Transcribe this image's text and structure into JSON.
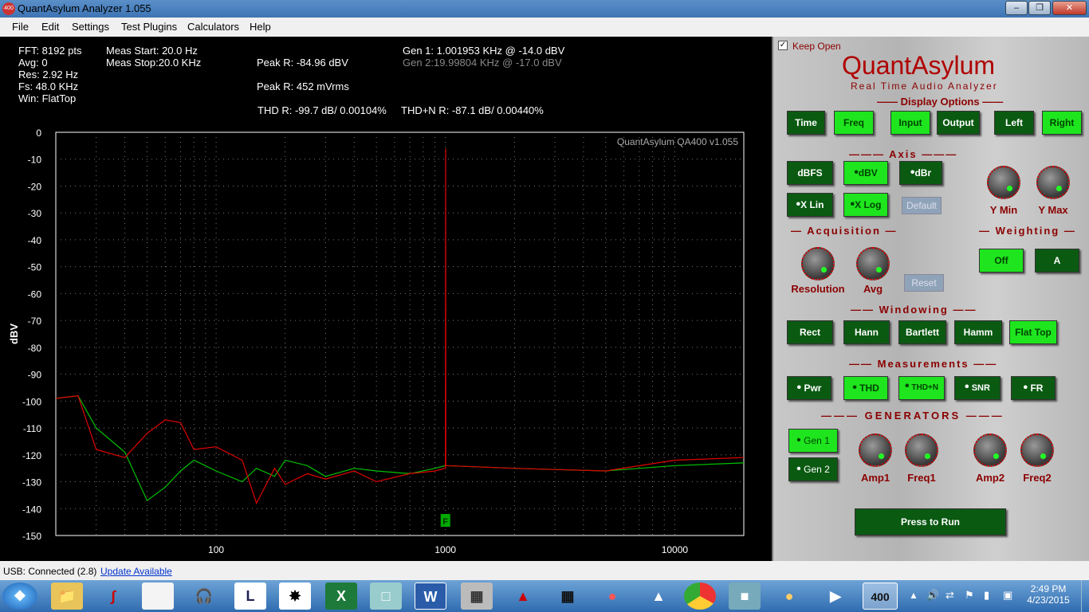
{
  "window": {
    "title": "QuantAsylum Analyzer 1.055",
    "icon_text": "400"
  },
  "menu": [
    "File",
    "Edit",
    "Settings",
    "Test Plugins",
    "Calculators",
    "Help"
  ],
  "readout": {
    "fft": "FFT: 8192 pts",
    "avg": "Avg: 0",
    "res": "Res: 2.92 Hz",
    "fs": "Fs: 48.0 KHz",
    "win": "Win: FlatTop",
    "meas_start": "Meas Start: 20.0 Hz",
    "meas_stop": "Meas Stop:20.0 KHz",
    "peak_dbv": "Peak R: -84.96 dBV",
    "peak_mv": "Peak R: 452 mVrms",
    "thd": "THD R: -99.7 dB/ 0.00104%",
    "thdn": "THD+N R: -87.1 dB/ 0.00440%",
    "gen1": "Gen 1: 1.001953 KHz @ -14.0  dBV",
    "gen2": "Gen 2:19.99804 KHz @ -17.0  dBV"
  },
  "chart_data": {
    "type": "line",
    "ylabel": "dBV",
    "watermark": "QuantAsylum QA400 v1.055",
    "x_scale": "log",
    "xlim": [
      20,
      20000
    ],
    "ylim": [
      -150,
      0
    ],
    "x_ticks": [
      "100",
      "1000",
      "10000"
    ],
    "y_ticks": [
      "0",
      "-10",
      "-20",
      "-30",
      "-40",
      "-50",
      "-60",
      "-70",
      "-80",
      "-90",
      "-100",
      "-110",
      "-120",
      "-130",
      "-140",
      "-150"
    ],
    "grid": true,
    "marker_label": "F",
    "series": [
      {
        "color": "#00c000",
        "x": [
          20,
          25,
          30,
          40,
          50,
          60,
          70,
          80,
          100,
          130,
          150,
          180,
          200,
          250,
          300,
          400,
          500,
          700,
          900,
          1000,
          2000,
          5000,
          10000,
          20000
        ],
        "y": [
          -99,
          -98,
          -110,
          -119,
          -137,
          -132,
          -126,
          -122,
          -126,
          -130,
          -125,
          -128,
          -122,
          -124,
          -128,
          -125,
          -126,
          -127,
          -125,
          -124,
          -125,
          -126,
          -124,
          -123
        ]
      },
      {
        "color": "#e00000",
        "x": [
          20,
          25,
          30,
          40,
          50,
          60,
          70,
          80,
          100,
          130,
          150,
          180,
          200,
          250,
          300,
          400,
          500,
          700,
          900,
          1000,
          1002,
          1004,
          2000,
          5000,
          10000,
          20000
        ],
        "y": [
          -99,
          -98,
          -118,
          -121,
          -112,
          -107,
          -108,
          -118,
          -117,
          -122,
          -138,
          -125,
          -131,
          -127,
          -129,
          -126,
          -130,
          -127,
          -126,
          -125,
          -6,
          -124,
          -125,
          -126,
          -122,
          -121
        ]
      }
    ]
  },
  "panel": {
    "keep_open": "Keep Open",
    "brand": "QuantAsylum",
    "subtitle": "Real Time Audio Analyzer",
    "display_options": "Display Options",
    "display": {
      "time": "Time",
      "freq": "Freq",
      "input": "Input",
      "output": "Output",
      "left": "Left",
      "right": "Right"
    },
    "axis_title": "Axis",
    "axis": {
      "dbfs": "dBFS",
      "dbv": "dBV",
      "dbr": "dBr",
      "xlin": "X Lin",
      "xlog": "X Log",
      "default": "Default",
      "ymin": "Y Min",
      "ymax": "Y Max"
    },
    "acquisition_title": "Acquisition",
    "acq": {
      "resolution": "Resolution",
      "avg": "Avg",
      "reset": "Reset"
    },
    "weighting_title": "Weighting",
    "weighting": {
      "off": "Off",
      "a": "A"
    },
    "windowing_title": "Windowing",
    "windowing": {
      "rect": "Rect",
      "hann": "Hann",
      "bartlett": "Bartlett",
      "hamm": "Hamm",
      "flattop": "Flat Top"
    },
    "measurements_title": "Measurements",
    "meas": {
      "pwr": "Pwr",
      "thd": "THD",
      "thdn": "THD+N",
      "snr": "SNR",
      "fr": "FR"
    },
    "generators_title": "GENERATORS",
    "gen": {
      "gen1": "Gen 1",
      "gen2": "Gen 2",
      "amp1": "Amp1",
      "freq1": "Freq1",
      "amp2": "Amp2",
      "freq2": "Freq2"
    },
    "run": "Press to Run"
  },
  "status": {
    "usb": "USB: Connected  (2.8)",
    "update": "Update Available"
  },
  "taskbar": {
    "time": "2:49 PM",
    "date": "4/23/2015",
    "qa_icon": "400"
  }
}
